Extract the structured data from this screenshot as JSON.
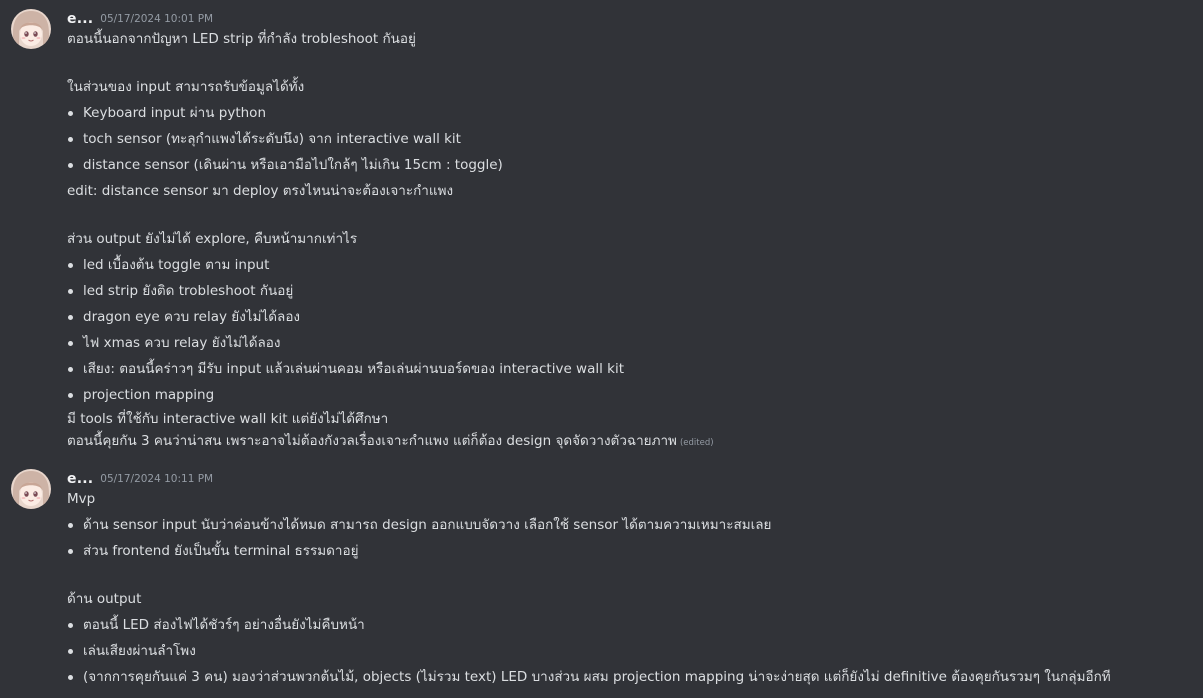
{
  "messages": [
    {
      "username": "e...",
      "timestamp": "05/17/2024 10:01 PM",
      "lines": {
        "l1": "ตอนนี้นอกจากปัญหา LED strip ที่กำลัง trobleshoot กันอยู่",
        "l2": "ในส่วนของ input สามารถรับข้อมูลได้ทั้ง",
        "b1": "Keyboard input ผ่าน python",
        "b2": "toch sensor (ทะลุกำแพงได้ระดับนึง) จาก interactive wall kit",
        "b3": "distance sensor (เดินผ่าน หรือเอามือไปใกล้ๆ ไม่เกิน 15cm : toggle)",
        "l3": "edit: distance sensor มา deploy ตรงไหนน่าจะต้องเจาะกำแพง",
        "l4": "ส่วน output ยังไม่ได้ explore, คืบหน้ามากเท่าไร",
        "b4": "led เบื้องต้น toggle ตาม input",
        "b5": "led strip ยังติด trobleshoot กันอยู่",
        "b6": "dragon eye ควบ relay ยังไม่ได้ลอง",
        "b7": "ไฟ xmas ควบ relay ยังไม่ได้ลอง",
        "b8": "เสียง: ตอนนี้คร่าวๆ มีรับ input แล้วเล่นผ่านคอม หรือเล่นผ่านบอร์ดของ interactive wall kit",
        "b9": "projection mapping",
        "l5": "มี tools ที่ใช้กับ interactive wall kit แต่ยังไม่ได้ศึกษา",
        "l6": "ตอนนี้คุยกัน 3 คนว่าน่าสน เพราะอาจไม่ต้องกังวลเรื่องเจาะกำแพง แต่ก็ต้อง design จุดจัดวางตัวฉายภาพ",
        "edited": "(edited)"
      }
    },
    {
      "username": "e...",
      "timestamp": "05/17/2024 10:11 PM",
      "lines": {
        "l1": "Mvp",
        "b1": "ด้าน sensor input นับว่าค่อนข้างได้หมด สามารถ design ออกแบบจัดวาง เลือกใช้ sensor ได้ตามความเหมาะสมเลย",
        "b2": "ส่วน frontend ยังเป็นขั้น terminal ธรรมดาอยู่",
        "l2": "ด้าน output",
        "b3": "ตอนนี้ LED ส่องไฟได้ชัวร์ๆ อย่างอื่นยังไม่คืบหน้า",
        "b4": "เล่นเสียงผ่านลำโพง",
        "b5": "(จากการคุยกันแค่ 3 คน) มองว่าส่วนพวกต้นไม้, objects (ไม่รวม text)  LED บางส่วน ผสม projection mapping น่าจะง่ายสุด แต่ก็ยังไม่ definitive ต้องคุยกันรวมๆ ในกลุ่มอีกที"
      }
    }
  ]
}
